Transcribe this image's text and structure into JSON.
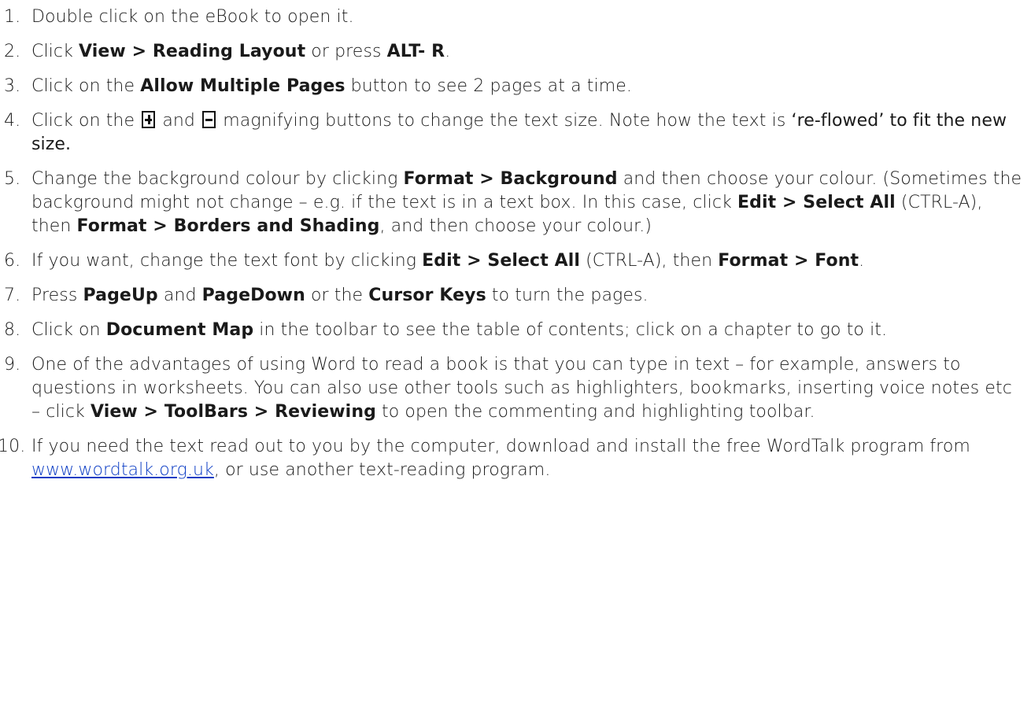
{
  "items": [
    {
      "num": "1.",
      "parts": [
        "Double click on the eBook to open it."
      ]
    },
    {
      "num": "2.",
      "parts": [
        "Click ",
        "View > Reading Layout",
        " or press ",
        "ALT- R",
        "."
      ]
    },
    {
      "num": "3.",
      "parts": [
        "Click on the ",
        "Allow Multiple Pages",
        " button to see 2 pages at a time."
      ]
    },
    {
      "num": "4.",
      "parts": [
        "Click on the",
        "and",
        "magnifying buttons to change the text size. Note how the text is ",
        "‘re-flowed’ to fit the new size."
      ]
    },
    {
      "num": "5.",
      "parts": [
        "Change the background colour by clicking ",
        "Format > Background",
        " and then choose your colour. (Sometimes the background might not change – e.g. if the text is in a text box. In this case, click ",
        "Edit > Select All",
        " (CTRL-A), then ",
        "Format > Borders and Shading",
        ", and then choose your colour.)"
      ]
    },
    {
      "num": "6.",
      "parts": [
        "If you want, change the text font by clicking ",
        "Edit > Select All",
        " (CTRL-A), then ",
        "Format > Font",
        "."
      ]
    },
    {
      "num": "7.",
      "parts": [
        "Press ",
        "PageUp",
        " and ",
        "PageDown",
        " or the ",
        "Cursor Keys",
        " to turn the pages."
      ]
    },
    {
      "num": "8.",
      "parts": [
        "Click on ",
        "Document Map",
        " in the toolbar to see the table of contents; click on a chapter to go to it."
      ]
    },
    {
      "num": "9.",
      "parts": [
        "One of the advantages of using Word to read a book is that you can type in text – for example, answers to questions in worksheets. You can also use other tools such as highlighters, bookmarks, inserting voice notes etc – click ",
        "View > ToolBars > Reviewing",
        " to open the commenting and highlighting toolbar."
      ]
    },
    {
      "num": "10.",
      "parts": [
        "If you need the text read out to you by the computer, download and install the free WordTalk program from ",
        "www.wordtalk.org.uk",
        ", or use another text-reading program."
      ]
    }
  ]
}
